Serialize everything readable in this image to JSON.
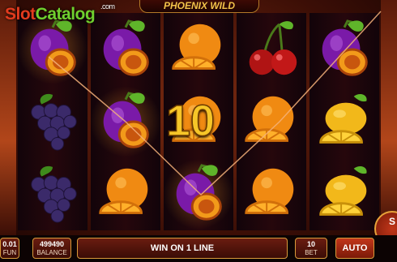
{
  "watermark": {
    "slot": "Slot",
    "catalog": "Catalog",
    "com": ".com"
  },
  "game_title": "PHOENIX WILD",
  "win_amount": "10",
  "win_message": "WIN ON 1 LINE",
  "reels": [
    [
      "plum",
      "grapes",
      "grapes"
    ],
    [
      "plum",
      "plum",
      "orange"
    ],
    [
      "orange",
      "orange",
      "plum"
    ],
    [
      "cherry",
      "orange",
      "orange"
    ],
    [
      "plum",
      "lemon",
      "lemon"
    ]
  ],
  "winning_cells": [
    [
      0,
      0
    ],
    [
      1,
      1
    ],
    [
      2,
      2
    ]
  ],
  "bottom_bar": {
    "coin_value": "0.01",
    "coin_label": "FUN",
    "balance_value": "499490",
    "balance_label": "BALANCE",
    "bet_value": "10",
    "bet_label": "BET",
    "auto_label": "AUTO",
    "spin_label": "S"
  },
  "colors": {
    "accent_gold": "#f6c628",
    "panel_red": "#6a1c10",
    "border_gold": "#d99a3a"
  }
}
